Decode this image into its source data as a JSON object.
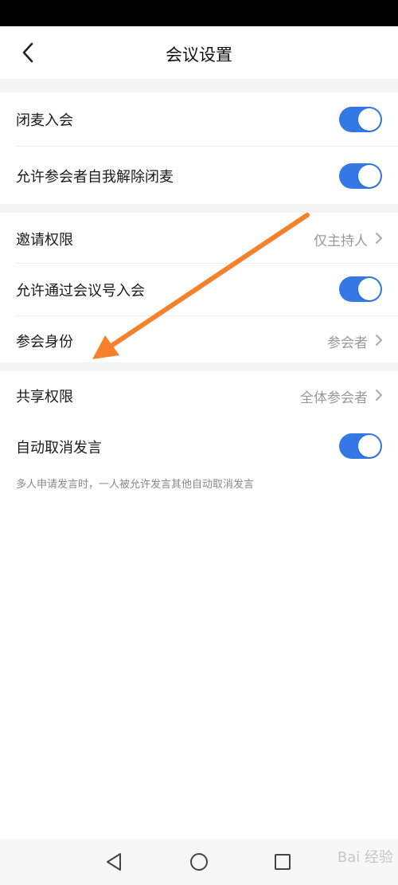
{
  "header": {
    "title": "会议设置"
  },
  "sections": [
    {
      "items": [
        {
          "label": "闭麦入会",
          "toggle": true
        },
        {
          "label": "允许参会者自我解除闭麦",
          "toggle": true
        }
      ]
    },
    {
      "items": [
        {
          "label": "邀请权限",
          "value": "仅主持人"
        },
        {
          "label": "允许通过会议号入会",
          "toggle": true
        },
        {
          "label": "参会身份",
          "value": "参会者"
        }
      ]
    },
    {
      "items": [
        {
          "label": "共享权限",
          "value": "全体参会者"
        },
        {
          "label": "自动取消发言",
          "toggle": true
        }
      ],
      "hint": "多人申请发言时，一人被允许发言其他自动取消发言"
    }
  ],
  "annotation": {
    "color": "#f5822a",
    "icon": "arrow-pointing-icon"
  },
  "colors": {
    "toggle_on": "#3378e4",
    "value_text": "#999999",
    "section_gap": "#f4f4f4"
  },
  "watermark": "Bai 经验"
}
